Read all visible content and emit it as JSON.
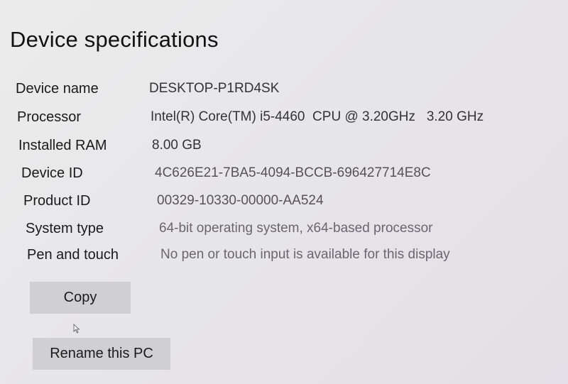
{
  "section": {
    "title": "Device specifications"
  },
  "specs": [
    {
      "label": "Device name",
      "value": "DESKTOP-P1RD4SK"
    },
    {
      "label": "Processor",
      "value": "Intel(R) Core(TM) i5-4460  CPU @ 3.20GHz   3.20 GHz"
    },
    {
      "label": "Installed RAM",
      "value": "8.00 GB"
    },
    {
      "label": "Device ID",
      "value": "4C626E21-7BA5-4094-BCCB-696427714E8C"
    },
    {
      "label": "Product ID",
      "value": "00329-10330-00000-AA524"
    },
    {
      "label": "System type",
      "value": "64-bit operating system, x64-based processor"
    },
    {
      "label": "Pen and touch",
      "value": "No pen or touch input is available for this display"
    }
  ],
  "buttons": {
    "copy_label": "Copy",
    "rename_label": "Rename this PC"
  },
  "icons": {
    "cursor": "mouse-pointer-icon"
  }
}
